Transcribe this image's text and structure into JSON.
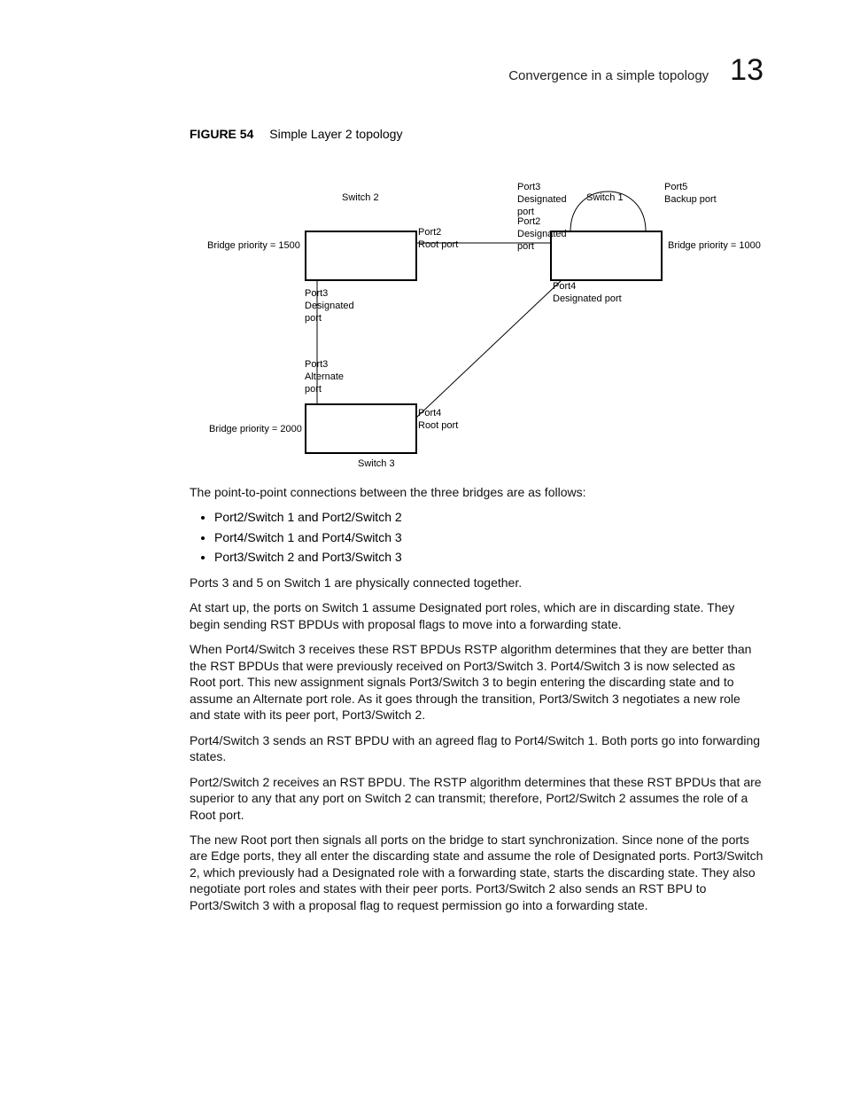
{
  "header": {
    "section_title": "Convergence in a simple topology",
    "chapter_number": "13"
  },
  "figure": {
    "label": "FIGURE 54",
    "title": "Simple Layer 2 topology"
  },
  "diagram": {
    "switch2": "Switch 2",
    "switch1": "Switch 1",
    "switch3": "Switch 3",
    "bp_left": "Bridge priority = 1500",
    "bp_right": "Bridge priority = 1000",
    "bp_bottom": "Bridge priority = 2000",
    "port3_desig_top": "Port3\nDesignated\nport",
    "port5_backup": "Port5\nBackup port",
    "port2_root": "Port2\nRoot port",
    "port2_desig": "Port2\nDesignated\nport",
    "port4_desig": "Port4\nDesignated port",
    "sw2_port3_desig": "Port3\nDesignated\nport",
    "port3_alt": "Port3\nAlternate\nport",
    "port4_root": "Port4\nRoot port"
  },
  "body": {
    "intro": "The point-to-point connections between the three bridges are as follows:",
    "bullets": [
      "Port2/Switch 1 and Port2/Switch 2",
      "Port4/Switch 1 and Port4/Switch 3",
      "Port3/Switch 2 and Port3/Switch 3"
    ],
    "p1": "Ports 3 and 5 on Switch 1 are physically connected together.",
    "p2": "At start up, the ports on Switch 1 assume Designated port roles, which are in discarding state. They begin sending RST BPDUs with proposal flags to move into a forwarding state.",
    "p3": "When Port4/Switch 3 receives these RST BPDUs RSTP algorithm determines that they are better than the RST BPDUs that were previously received on Port3/Switch 3. Port4/Switch 3 is now selected as Root port. This new assignment signals Port3/Switch 3 to begin entering the discarding state and to assume an Alternate port role. As it goes through the transition, Port3/Switch 3 negotiates a new role and state with its peer port, Port3/Switch 2.",
    "p4": "Port4/Switch 3 sends an RST BPDU with an agreed flag to Port4/Switch 1. Both ports go into forwarding states.",
    "p5": "Port2/Switch 2 receives an RST BPDU. The RSTP algorithm determines that these RST BPDUs that are superior to any that any port on Switch 2 can transmit; therefore, Port2/Switch 2 assumes the role of a Root port.",
    "p6": "The new Root port then signals all ports on the bridge to start synchronization. Since none of the ports are Edge ports, they all enter the discarding state and assume the role of Designated ports. Port3/Switch 2, which previously had a Designated role with a forwarding state, starts the discarding state. They also negotiate port roles and states with their peer ports. Port3/Switch 2 also sends an RST BPU to Port3/Switch 3 with a proposal flag to request permission go into a forwarding state."
  }
}
